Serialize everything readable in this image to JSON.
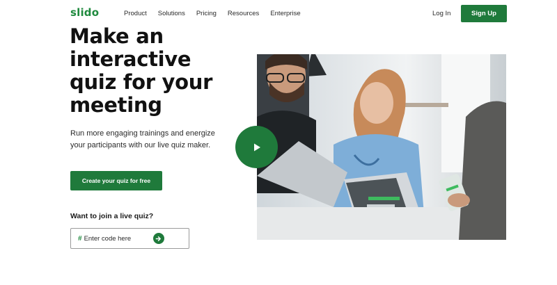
{
  "header": {
    "logo": "slido",
    "nav": [
      "Product",
      "Solutions",
      "Pricing",
      "Resources",
      "Enterprise"
    ],
    "login": "Log In",
    "signup": "Sign Up"
  },
  "hero": {
    "headline": "Make an interactive quiz for your meeting",
    "subtitle": "Run more engaging trainings and energize your participants with our live quiz maker.",
    "cta": "Create your quiz for free"
  },
  "join": {
    "label": "Want to join a live quiz?",
    "hash": "#",
    "placeholder": "Enter code here"
  },
  "colors": {
    "brand": "#1f7a3b",
    "logo": "#1f8a3e"
  },
  "icons": {
    "play": "play-icon",
    "submit": "arrow-right-icon"
  }
}
